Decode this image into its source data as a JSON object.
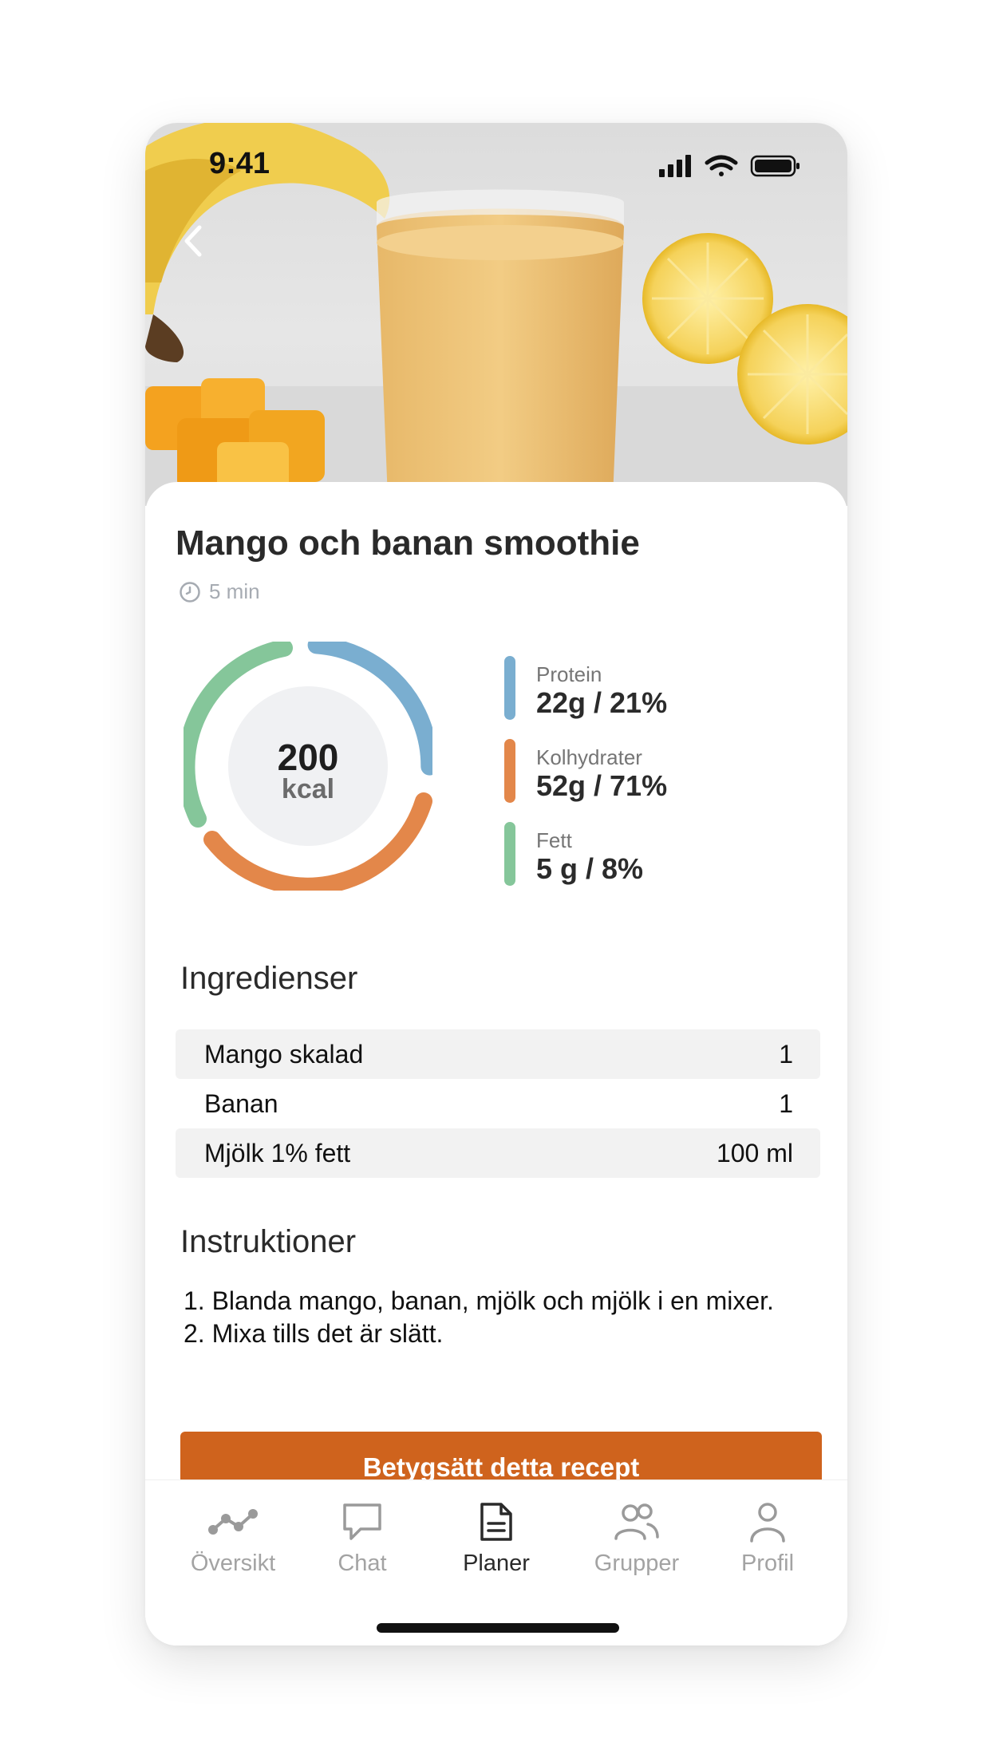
{
  "status_bar": {
    "time": "9:41"
  },
  "hero": {
    "back_icon": "chevron-left-icon"
  },
  "recipe": {
    "title": "Mango och banan smoothie",
    "prep_time": "5 min",
    "calories": {
      "value": "200",
      "unit": "kcal"
    },
    "macros": [
      {
        "label": "Protein",
        "value": "22g / 21%",
        "color": "#7aaed0",
        "percent": 21
      },
      {
        "label": "Kolhydrater",
        "value": "52g / 71%",
        "color": "#e3874a",
        "percent": 71
      },
      {
        "label": "Fett",
        "value": "5 g / 8%",
        "color": "#85c69a",
        "percent": 8
      }
    ]
  },
  "ingredients": {
    "title": "Ingredienser",
    "items": [
      {
        "name": "Mango skalad",
        "amount": "1"
      },
      {
        "name": "Banan",
        "amount": "1"
      },
      {
        "name": "Mjölk 1% fett",
        "amount": "100 ml"
      }
    ]
  },
  "instructions": {
    "title": "Instruktioner",
    "steps": [
      "1. Blanda mango, banan, mjölk och mjölk i en mixer.",
      "2. Mixa tills det är slätt."
    ]
  },
  "cta": {
    "label": "Betygsätt detta recept",
    "color": "#cf631d"
  },
  "tabbar": {
    "active": "Planer",
    "tabs": [
      {
        "label": "Översikt",
        "icon": "chart-line-icon"
      },
      {
        "label": "Chat",
        "icon": "chat-bubble-icon"
      },
      {
        "label": "Planer",
        "icon": "document-icon"
      },
      {
        "label": "Grupper",
        "icon": "group-icon"
      },
      {
        "label": "Profil",
        "icon": "person-icon"
      }
    ]
  }
}
